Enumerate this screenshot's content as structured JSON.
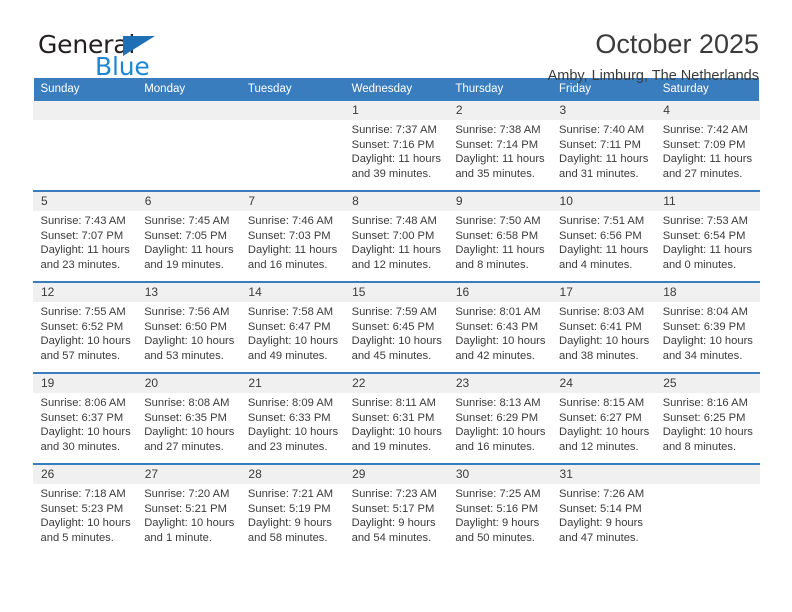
{
  "brand": {
    "name_part1": "General",
    "name_part2": "Blue",
    "triangle_color": "#1f6fb6",
    "blue_color": "#1c87d4"
  },
  "header": {
    "title": "October 2025",
    "subtitle": "Amby, Limburg, The Netherlands"
  },
  "theme": {
    "header_blue": "#3a7dbf",
    "daynum_band": "#f0f0f0",
    "text": "#3b3b3b"
  },
  "weekdays": [
    "Sunday",
    "Monday",
    "Tuesday",
    "Wednesday",
    "Thursday",
    "Friday",
    "Saturday"
  ],
  "weeks": [
    [
      {
        "day": "",
        "lines": []
      },
      {
        "day": "",
        "lines": []
      },
      {
        "day": "",
        "lines": []
      },
      {
        "day": "1",
        "lines": [
          "Sunrise: 7:37 AM",
          "Sunset: 7:16 PM",
          "Daylight: 11 hours",
          "and 39 minutes."
        ]
      },
      {
        "day": "2",
        "lines": [
          "Sunrise: 7:38 AM",
          "Sunset: 7:14 PM",
          "Daylight: 11 hours",
          "and 35 minutes."
        ]
      },
      {
        "day": "3",
        "lines": [
          "Sunrise: 7:40 AM",
          "Sunset: 7:11 PM",
          "Daylight: 11 hours",
          "and 31 minutes."
        ]
      },
      {
        "day": "4",
        "lines": [
          "Sunrise: 7:42 AM",
          "Sunset: 7:09 PM",
          "Daylight: 11 hours",
          "and 27 minutes."
        ]
      }
    ],
    [
      {
        "day": "5",
        "lines": [
          "Sunrise: 7:43 AM",
          "Sunset: 7:07 PM",
          "Daylight: 11 hours",
          "and 23 minutes."
        ]
      },
      {
        "day": "6",
        "lines": [
          "Sunrise: 7:45 AM",
          "Sunset: 7:05 PM",
          "Daylight: 11 hours",
          "and 19 minutes."
        ]
      },
      {
        "day": "7",
        "lines": [
          "Sunrise: 7:46 AM",
          "Sunset: 7:03 PM",
          "Daylight: 11 hours",
          "and 16 minutes."
        ]
      },
      {
        "day": "8",
        "lines": [
          "Sunrise: 7:48 AM",
          "Sunset: 7:00 PM",
          "Daylight: 11 hours",
          "and 12 minutes."
        ]
      },
      {
        "day": "9",
        "lines": [
          "Sunrise: 7:50 AM",
          "Sunset: 6:58 PM",
          "Daylight: 11 hours",
          "and 8 minutes."
        ]
      },
      {
        "day": "10",
        "lines": [
          "Sunrise: 7:51 AM",
          "Sunset: 6:56 PM",
          "Daylight: 11 hours",
          "and 4 minutes."
        ]
      },
      {
        "day": "11",
        "lines": [
          "Sunrise: 7:53 AM",
          "Sunset: 6:54 PM",
          "Daylight: 11 hours",
          "and 0 minutes."
        ]
      }
    ],
    [
      {
        "day": "12",
        "lines": [
          "Sunrise: 7:55 AM",
          "Sunset: 6:52 PM",
          "Daylight: 10 hours",
          "and 57 minutes."
        ]
      },
      {
        "day": "13",
        "lines": [
          "Sunrise: 7:56 AM",
          "Sunset: 6:50 PM",
          "Daylight: 10 hours",
          "and 53 minutes."
        ]
      },
      {
        "day": "14",
        "lines": [
          "Sunrise: 7:58 AM",
          "Sunset: 6:47 PM",
          "Daylight: 10 hours",
          "and 49 minutes."
        ]
      },
      {
        "day": "15",
        "lines": [
          "Sunrise: 7:59 AM",
          "Sunset: 6:45 PM",
          "Daylight: 10 hours",
          "and 45 minutes."
        ]
      },
      {
        "day": "16",
        "lines": [
          "Sunrise: 8:01 AM",
          "Sunset: 6:43 PM",
          "Daylight: 10 hours",
          "and 42 minutes."
        ]
      },
      {
        "day": "17",
        "lines": [
          "Sunrise: 8:03 AM",
          "Sunset: 6:41 PM",
          "Daylight: 10 hours",
          "and 38 minutes."
        ]
      },
      {
        "day": "18",
        "lines": [
          "Sunrise: 8:04 AM",
          "Sunset: 6:39 PM",
          "Daylight: 10 hours",
          "and 34 minutes."
        ]
      }
    ],
    [
      {
        "day": "19",
        "lines": [
          "Sunrise: 8:06 AM",
          "Sunset: 6:37 PM",
          "Daylight: 10 hours",
          "and 30 minutes."
        ]
      },
      {
        "day": "20",
        "lines": [
          "Sunrise: 8:08 AM",
          "Sunset: 6:35 PM",
          "Daylight: 10 hours",
          "and 27 minutes."
        ]
      },
      {
        "day": "21",
        "lines": [
          "Sunrise: 8:09 AM",
          "Sunset: 6:33 PM",
          "Daylight: 10 hours",
          "and 23 minutes."
        ]
      },
      {
        "day": "22",
        "lines": [
          "Sunrise: 8:11 AM",
          "Sunset: 6:31 PM",
          "Daylight: 10 hours",
          "and 19 minutes."
        ]
      },
      {
        "day": "23",
        "lines": [
          "Sunrise: 8:13 AM",
          "Sunset: 6:29 PM",
          "Daylight: 10 hours",
          "and 16 minutes."
        ]
      },
      {
        "day": "24",
        "lines": [
          "Sunrise: 8:15 AM",
          "Sunset: 6:27 PM",
          "Daylight: 10 hours",
          "and 12 minutes."
        ]
      },
      {
        "day": "25",
        "lines": [
          "Sunrise: 8:16 AM",
          "Sunset: 6:25 PM",
          "Daylight: 10 hours",
          "and 8 minutes."
        ]
      }
    ],
    [
      {
        "day": "26",
        "lines": [
          "Sunrise: 7:18 AM",
          "Sunset: 5:23 PM",
          "Daylight: 10 hours",
          "and 5 minutes."
        ]
      },
      {
        "day": "27",
        "lines": [
          "Sunrise: 7:20 AM",
          "Sunset: 5:21 PM",
          "Daylight: 10 hours",
          "and 1 minute."
        ]
      },
      {
        "day": "28",
        "lines": [
          "Sunrise: 7:21 AM",
          "Sunset: 5:19 PM",
          "Daylight: 9 hours",
          "and 58 minutes."
        ]
      },
      {
        "day": "29",
        "lines": [
          "Sunrise: 7:23 AM",
          "Sunset: 5:17 PM",
          "Daylight: 9 hours",
          "and 54 minutes."
        ]
      },
      {
        "day": "30",
        "lines": [
          "Sunrise: 7:25 AM",
          "Sunset: 5:16 PM",
          "Daylight: 9 hours",
          "and 50 minutes."
        ]
      },
      {
        "day": "31",
        "lines": [
          "Sunrise: 7:26 AM",
          "Sunset: 5:14 PM",
          "Daylight: 9 hours",
          "and 47 minutes."
        ]
      },
      {
        "day": "",
        "lines": []
      }
    ]
  ]
}
